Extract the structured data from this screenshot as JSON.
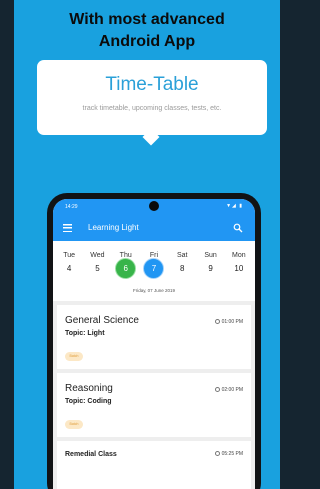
{
  "headline": {
    "line1": "With most advanced",
    "line2": "Android App"
  },
  "feature": {
    "title": "Time-Table",
    "subtitle": "track timetable, upcoming classes, tests, etc."
  },
  "phone": {
    "status_time": "14:29",
    "status_icons": "▼◢ ▮",
    "app_title": "Learning Light",
    "calendar": {
      "days": [
        "Tue",
        "Wed",
        "Thu",
        "Fri",
        "Sat",
        "Sun",
        "Mon"
      ],
      "dates": [
        "4",
        "5",
        "6",
        "7",
        "8",
        "9",
        "10"
      ],
      "today_index": 2,
      "selected_index": 3,
      "selected_full": "Friday, 07 June 2019"
    },
    "classes": [
      {
        "title": "General Science",
        "topic": "Topic: Light",
        "time": "01:00 PM",
        "tag": "Batch"
      },
      {
        "title": "Reasoning",
        "topic": "Topic: Coding",
        "time": "02:00 PM",
        "tag": "Batch"
      },
      {
        "title": "Remedial Class",
        "topic": "",
        "time": "05:25 PM",
        "tag": ""
      }
    ]
  },
  "colors": {
    "background": "#19a1df",
    "app_bar": "#2196f3",
    "today": "#38b44a",
    "selected": "#2196f3"
  }
}
